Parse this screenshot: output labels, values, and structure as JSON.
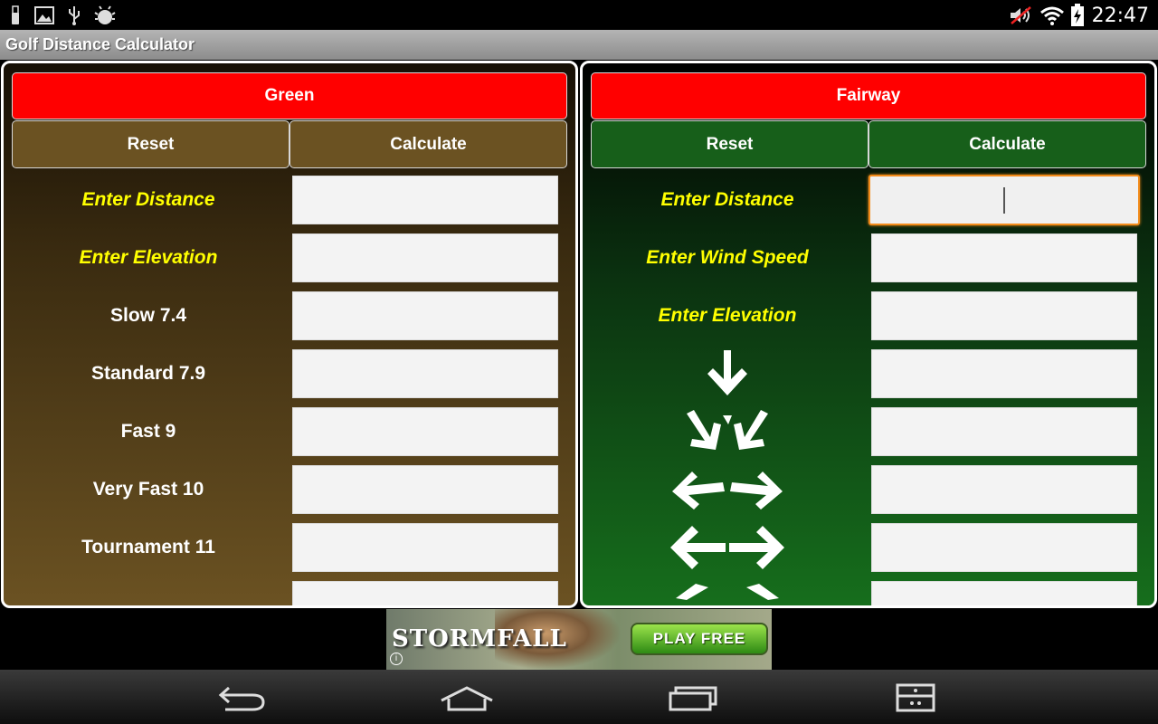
{
  "status_bar": {
    "time": "22:47",
    "left_icons": [
      "usb-icon",
      "image-icon",
      "usb-debug-icon",
      "android-bug-icon"
    ],
    "right_icons": [
      "muted-speaker-icon",
      "wifi-icon",
      "battery-charging-icon"
    ]
  },
  "app": {
    "title": "Golf Distance Calculator"
  },
  "green_panel": {
    "header": "Green",
    "reset_label": "Reset",
    "calculate_label": "Calculate",
    "rows": [
      {
        "label": "Enter Distance",
        "highlight": true
      },
      {
        "label": "Enter Elevation",
        "highlight": true
      },
      {
        "label": "Slow 7.4",
        "highlight": false
      },
      {
        "label": "Standard 7.9",
        "highlight": false
      },
      {
        "label": "Fast 9",
        "highlight": false
      },
      {
        "label": "Very Fast 10",
        "highlight": false
      },
      {
        "label": "Tournament 11",
        "highlight": false
      }
    ]
  },
  "fairway_panel": {
    "header": "Fairway",
    "reset_label": "Reset",
    "calculate_label": "Calculate",
    "rows": [
      {
        "label": "Enter Distance",
        "highlight": true
      },
      {
        "label": "Enter Wind Speed",
        "highlight": true
      },
      {
        "label": "Enter Elevation",
        "highlight": true
      }
    ],
    "wind_icons": [
      "wind-headwind-arrow-icon",
      "wind-diagonal-arrows-icon",
      "wind-angled-cross-arrows-icon",
      "wind-crosswind-arrows-icon"
    ]
  },
  "ad": {
    "brand": "STORMFALL",
    "cta": "PLAY FREE"
  },
  "nav_bar": {
    "buttons": [
      "back-icon",
      "home-icon",
      "recent-apps-icon",
      "menu-icon"
    ]
  },
  "colors": {
    "header_red": "#ff0000",
    "label_yellow": "#ffff00",
    "focus_orange": "#f28b1a",
    "green_btn": "#175f1a",
    "brown_btn": "#6b5222"
  }
}
